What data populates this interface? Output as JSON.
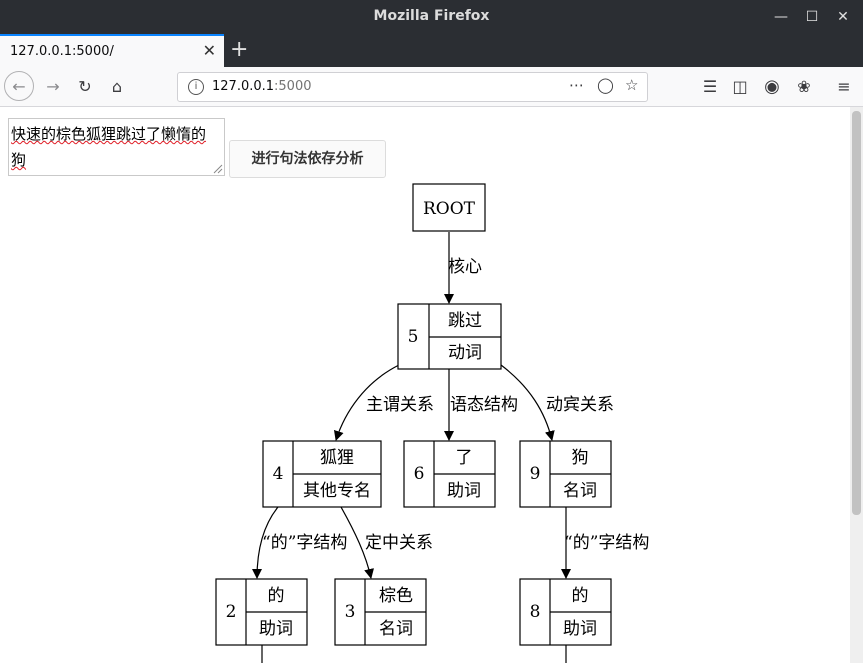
{
  "window": {
    "title": "Mozilla Firefox"
  },
  "tab": {
    "label": "127.0.0.1:5000/"
  },
  "url": {
    "host": "127.0.0.1",
    "port": ":5000"
  },
  "page": {
    "input_value": "快速的棕色狐狸跳过了懒惰的狗",
    "input_line1": "快速的棕色狐狸跳过了懒惰的",
    "input_line2": "狗",
    "analyze_button": "进行句法依存分析"
  },
  "tree": {
    "root": "ROOT",
    "nodes": [
      {
        "id": "5",
        "word": "跳过",
        "pos": "动词"
      },
      {
        "id": "4",
        "word": "狐狸",
        "pos": "其他专名"
      },
      {
        "id": "6",
        "word": "了",
        "pos": "助词"
      },
      {
        "id": "9",
        "word": "狗",
        "pos": "名词"
      },
      {
        "id": "2",
        "word": "的",
        "pos": "助词"
      },
      {
        "id": "3",
        "word": "棕色",
        "pos": "名词"
      },
      {
        "id": "8",
        "word": "的",
        "pos": "助词"
      }
    ],
    "edges": [
      {
        "label": "核心"
      },
      {
        "label": "主谓关系"
      },
      {
        "label": "语态结构"
      },
      {
        "label": "动宾关系"
      },
      {
        "label": "“的”字结构"
      },
      {
        "label": "定中关系"
      },
      {
        "label": "“的”字结构"
      }
    ]
  }
}
